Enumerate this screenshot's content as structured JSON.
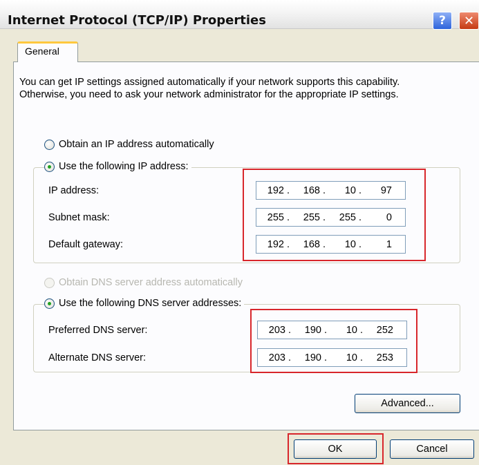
{
  "window": {
    "title": "Internet Protocol (TCP/IP) Properties",
    "help_glyph": "?",
    "close_glyph": "✕"
  },
  "tabs": [
    {
      "label": "General",
      "selected": true
    }
  ],
  "intro_text": "You can get IP settings assigned automatically if your network supports this capability. Otherwise, you need to ask your network administrator for the appropriate IP settings.",
  "ip_section": {
    "auto_label": "Obtain an IP address automatically",
    "auto_selected": false,
    "manual_label": "Use the following IP address:",
    "manual_selected": true,
    "fields": [
      {
        "label": "IP address:",
        "octets": [
          "192",
          "168",
          "10",
          "97"
        ]
      },
      {
        "label": "Subnet mask:",
        "octets": [
          "255",
          "255",
          "255",
          "0"
        ]
      },
      {
        "label": "Default gateway:",
        "octets": [
          "192",
          "168",
          "10",
          "1"
        ]
      }
    ]
  },
  "dns_section": {
    "auto_label": "Obtain DNS server address automatically",
    "auto_selected": false,
    "auto_disabled": true,
    "manual_label": "Use the following DNS server addresses:",
    "manual_selected": true,
    "fields": [
      {
        "label": "Preferred DNS server:",
        "octets": [
          "203",
          "190",
          "10",
          "252"
        ]
      },
      {
        "label": "Alternate DNS server:",
        "octets": [
          "203",
          "190",
          "10",
          "253"
        ]
      }
    ]
  },
  "buttons": {
    "advanced": "Advanced...",
    "ok": "OK",
    "cancel": "Cancel"
  },
  "colors": {
    "highlight": "#d8262b",
    "radio_dot": "#21a121",
    "tab_accent": "#ffc83d",
    "dialog_bg": "#ece9d8"
  }
}
